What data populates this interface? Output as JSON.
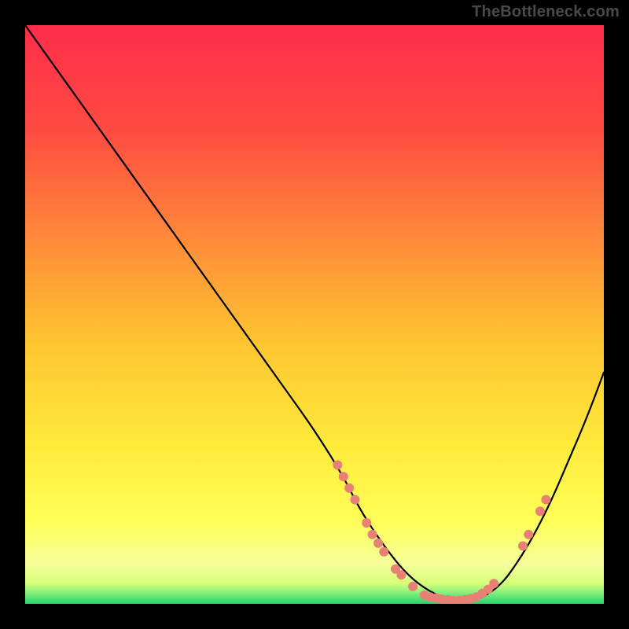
{
  "watermark": "TheBottleneck.com",
  "chart_data": {
    "type": "line",
    "title": "",
    "xlabel": "",
    "ylabel": "",
    "xlim": [
      0,
      100
    ],
    "ylim": [
      0,
      100
    ],
    "grid": false,
    "legend": false,
    "background_gradient": {
      "top": "#ff2d4b",
      "mid_upper": "#ff6a3a",
      "mid": "#ffd829",
      "mid_lower": "#ffff6e",
      "bottom_strip_1": "#d6ff7a",
      "bottom_strip_2": "#27e07a"
    },
    "series": [
      {
        "name": "bottleneck-curve",
        "color": "#000000",
        "x": [
          0,
          5,
          10,
          15,
          20,
          25,
          30,
          35,
          40,
          45,
          50,
          55,
          58,
          62,
          66,
          70,
          74,
          78,
          82,
          85,
          88,
          91,
          94,
          97,
          100
        ],
        "y": [
          100,
          93,
          86,
          79,
          72,
          65,
          58,
          51,
          44,
          37,
          30,
          22,
          16,
          10,
          5,
          2,
          0.5,
          0.5,
          3,
          7,
          12,
          18,
          25,
          32,
          40
        ]
      }
    ],
    "markers": {
      "name": "highlight-points",
      "color": "#e98076",
      "points": [
        {
          "x": 54,
          "y": 24
        },
        {
          "x": 55,
          "y": 22
        },
        {
          "x": 56,
          "y": 20
        },
        {
          "x": 57,
          "y": 18
        },
        {
          "x": 59,
          "y": 14
        },
        {
          "x": 60,
          "y": 12
        },
        {
          "x": 61,
          "y": 10.5
        },
        {
          "x": 62,
          "y": 9
        },
        {
          "x": 64,
          "y": 6
        },
        {
          "x": 65,
          "y": 5
        },
        {
          "x": 67,
          "y": 3
        },
        {
          "x": 69,
          "y": 1.5
        },
        {
          "x": 70,
          "y": 1.2
        },
        {
          "x": 71,
          "y": 1
        },
        {
          "x": 72,
          "y": 0.8
        },
        {
          "x": 73,
          "y": 0.7
        },
        {
          "x": 74,
          "y": 0.6
        },
        {
          "x": 75,
          "y": 0.6
        },
        {
          "x": 76,
          "y": 0.7
        },
        {
          "x": 77,
          "y": 0.9
        },
        {
          "x": 78,
          "y": 1.2
        },
        {
          "x": 79,
          "y": 1.8
        },
        {
          "x": 80,
          "y": 2.5
        },
        {
          "x": 81,
          "y": 3.5
        },
        {
          "x": 86,
          "y": 10
        },
        {
          "x": 87,
          "y": 12
        },
        {
          "x": 89,
          "y": 16
        },
        {
          "x": 90,
          "y": 18
        }
      ]
    }
  }
}
